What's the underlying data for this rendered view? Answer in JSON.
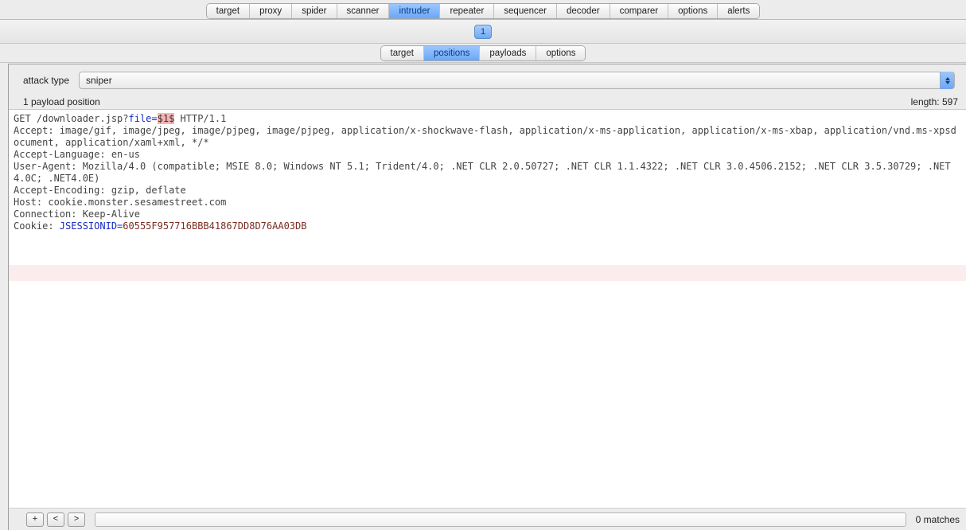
{
  "mainTabs": [
    "target",
    "proxy",
    "spider",
    "scanner",
    "intruder",
    "repeater",
    "sequencer",
    "decoder",
    "comparer",
    "options",
    "alerts"
  ],
  "mainActive": "intruder",
  "attackTabs": [
    "1"
  ],
  "subTabs": [
    "target",
    "positions",
    "payloads",
    "options"
  ],
  "subActive": "positions",
  "attackTypeLabel": "attack type",
  "attackTypeValue": "sniper",
  "payloadPositions": "1 payload position",
  "lengthLabel": "length: 597",
  "request": {
    "line1a": "GET /downloader.jsp?",
    "param": "file=",
    "marker": "$1$",
    "line1b": " HTTP/1.1",
    "line2": "Accept: image/gif, image/jpeg, image/pjpeg, image/pjpeg, application/x-shockwave-flash, application/x-ms-application, application/x-ms-xbap, application/vnd.ms-xpsdocument, application/xaml+xml, */*",
    "line3": "Accept-Language: en-us",
    "line4": "User-Agent: Mozilla/4.0 (compatible; MSIE 8.0; Windows NT 5.1; Trident/4.0; .NET CLR 2.0.50727; .NET CLR 1.1.4322; .NET CLR 3.0.4506.2152; .NET CLR 3.5.30729; .NET4.0C; .NET4.0E)",
    "line5": "Accept-Encoding: gzip, deflate",
    "line6": "Host: cookie.monster.sesamestreet.com",
    "line7": "Connection: Keep-Alive",
    "line8a": "Cookie: ",
    "cookieKey": "JSESSIONID=",
    "cookieVal": "60555F957716BBB41867DD8D76AA03DB"
  },
  "btnPlus": "+",
  "btnPrev": "<",
  "btnNext": ">",
  "matches": "0 matches"
}
